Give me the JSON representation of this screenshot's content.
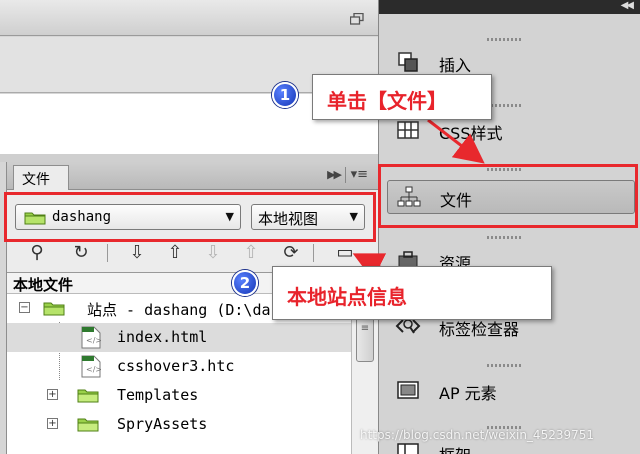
{
  "files_panel": {
    "tab_label": "文件",
    "site_select": {
      "value": "dashang"
    },
    "view_select": {
      "value": "本地视图"
    },
    "header": "本地文件",
    "tree": [
      {
        "label": "站点 - dashang (D:\\dashang)",
        "type": "site",
        "expanded": true
      },
      {
        "label": "index.html",
        "type": "file",
        "selected": true
      },
      {
        "label": "csshover3.htc",
        "type": "file"
      },
      {
        "label": "Templates",
        "type": "folder",
        "expanded": false
      },
      {
        "label": "SpryAssets",
        "type": "folder",
        "expanded": false
      }
    ]
  },
  "dock": {
    "items": [
      {
        "label": "插入",
        "icon": "insert-icon"
      },
      {
        "label": "CSS样式",
        "icon": "css-styles-icon"
      },
      {
        "label": "文件",
        "icon": "files-icon",
        "active": true
      },
      {
        "label": "资源",
        "icon": "assets-icon"
      },
      {
        "label": "标签检查器",
        "icon": "tag-inspector-icon"
      },
      {
        "label": "AP 元素",
        "icon": "ap-elements-icon"
      },
      {
        "label": "框架",
        "icon": "frames-icon"
      }
    ]
  },
  "annotations": {
    "callout_1": {
      "number": "1",
      "text": "单击【文件】"
    },
    "callout_2": {
      "number": "2",
      "text": "本地站点信息"
    }
  },
  "watermark": "https://blog.csdn.net/weixin_45239751",
  "colors": {
    "annotation_red": "#e8282d",
    "badge_blue": "#1e4bd8"
  }
}
